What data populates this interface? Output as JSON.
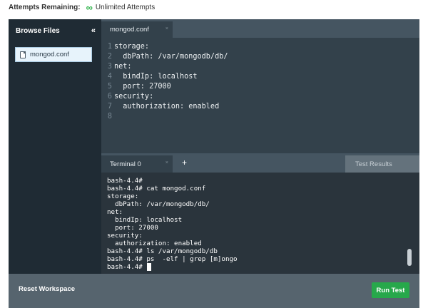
{
  "attempts": {
    "label": "Attempts Remaining:",
    "icon": "infinity-icon",
    "value": "Unlimited Attempts"
  },
  "sidebar": {
    "title": "Browse Files",
    "collapse_icon": "double-chevron-left-icon",
    "files": [
      {
        "name": "mongod.conf",
        "icon": "file-icon"
      }
    ]
  },
  "editor": {
    "tab": {
      "label": "mongod.conf",
      "close": "×"
    },
    "lines": [
      {
        "num": "1",
        "text": "storage:"
      },
      {
        "num": "2",
        "text": "  dbPath: /var/mongodb/db/"
      },
      {
        "num": "3",
        "text": "net:"
      },
      {
        "num": "4",
        "text": "  bindIp: localhost"
      },
      {
        "num": "5",
        "text": "  port: 27000"
      },
      {
        "num": "6",
        "text": "security:"
      },
      {
        "num": "7",
        "text": "  authorization: enabled"
      },
      {
        "num": "8",
        "text": ""
      }
    ]
  },
  "terminal": {
    "tab": {
      "label": "Terminal 0",
      "close": "×"
    },
    "add_label": "+",
    "test_results_label": "Test Results",
    "lines": [
      "bash-4.4#",
      "bash-4.4# cat mongod.conf",
      "storage:",
      "  dbPath: /var/mongodb/db/",
      "net:",
      "  bindIp: localhost",
      "  port: 27000",
      "security:",
      "  authorization: enabled",
      "bash-4.4# ls /var/mongodb/db",
      "bash-4.4# ps  -elf | grep [m]ongo",
      "bash-4.4# "
    ]
  },
  "footer": {
    "reset_label": "Reset Workspace",
    "run_label": "Run Test"
  },
  "colors": {
    "accent_green": "#27a84b",
    "sidebar_bg": "#1f2b34",
    "editor_bg": "#33414b",
    "terminal_bg": "#2a343c"
  }
}
